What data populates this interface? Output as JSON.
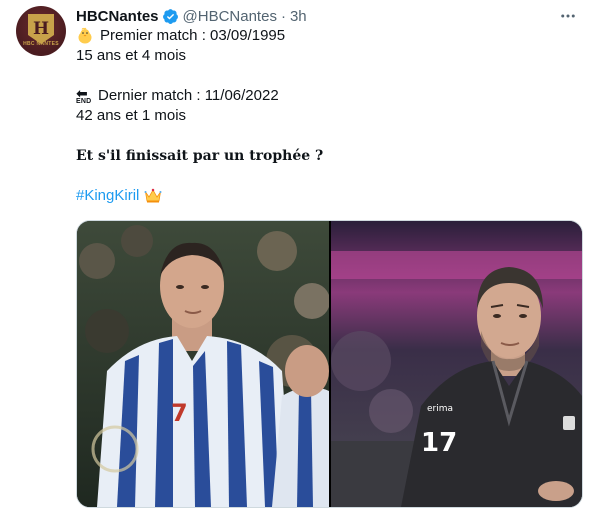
{
  "tweet": {
    "author_name": "HBCNantes",
    "handle": "@HBCNantes",
    "separator": "·",
    "time": "3h",
    "avatar_logo_letter": "H",
    "avatar_logo_text": "HBC NANTES",
    "lines": {
      "first_match": "Premier match : 03/09/1995",
      "first_age": "15 ans et 4 mois",
      "end_icon_label": "END",
      "last_match": "Dernier match : 11/06/2022",
      "last_age": "42 ans et 1 mois",
      "question": "Et s'il finissait par un trophée ?",
      "hashtag": "#KingKiril"
    },
    "icons": {
      "first_match": "baby-chick-icon",
      "last_match": "end-arrow-icon",
      "hashtag": "crown-icon",
      "verified": "verified-badge-icon",
      "more": "more-options-icon"
    },
    "media": {
      "left_jersey_number": "7",
      "right_jersey_number": "17",
      "right_brand": "erima"
    },
    "colors": {
      "link": "#1d9bf0",
      "verified": "#1d9bf0",
      "secondary_text": "#536471",
      "brand_maroon": "#4a1c20",
      "brand_gold": "#c8a24a"
    }
  }
}
